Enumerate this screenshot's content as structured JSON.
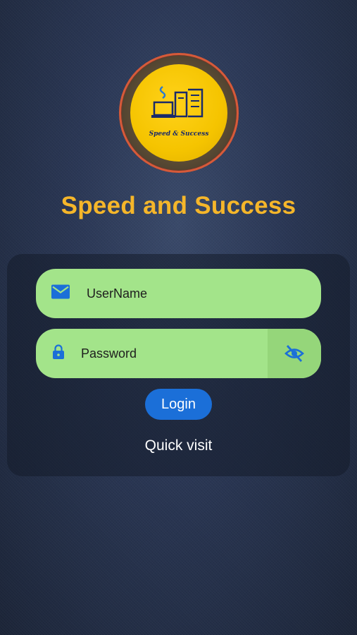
{
  "logo": {
    "text": "Speed & Success",
    "colors": {
      "ring": "#d65a3a",
      "fill": "#f5c400",
      "ink": "#1a2a6a"
    }
  },
  "app_title": "Speed and Success",
  "login_form": {
    "username": {
      "placeholder": "UserName",
      "value": "",
      "icon": "mail-icon"
    },
    "password": {
      "placeholder": "Password",
      "value": "",
      "icon": "lock-icon",
      "toggle_icon": "eye-off-icon"
    },
    "login_label": "Login",
    "quick_visit_label": "Quick visit"
  },
  "colors": {
    "title": "#f5b62a",
    "field_bg": "#a3e48a",
    "button": "#1b6fd8",
    "icon": "#1b6fd8"
  }
}
